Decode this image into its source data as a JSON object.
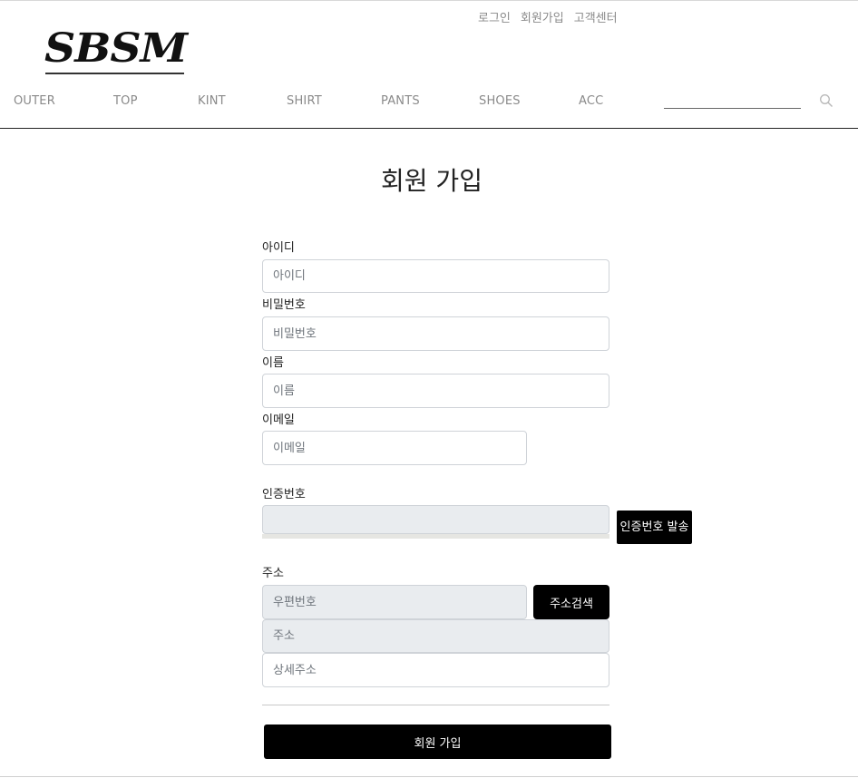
{
  "header": {
    "util_links": [
      "로그인",
      "회원가입",
      "고객센터"
    ],
    "logo_text": "SBSM",
    "nav": [
      "OUTER",
      "TOP",
      "KINT",
      "SHIRT",
      "PANTS",
      "SHOES",
      "ACC"
    ],
    "search": {
      "value": "",
      "placeholder": "",
      "icon": "search-icon"
    }
  },
  "form": {
    "title": "회원 가입",
    "id": {
      "label": "아이디",
      "placeholder": "아이디"
    },
    "password": {
      "label": "비밀번호",
      "placeholder": "비밀번호"
    },
    "name": {
      "label": "이름",
      "placeholder": "이름"
    },
    "email": {
      "label": "이메일",
      "placeholder": "이메일"
    },
    "cert": {
      "label": "인증번호",
      "value": "",
      "button": "인증번호 발송"
    },
    "address": {
      "label": "주소",
      "zip_placeholder": "우편번호",
      "search_button": "주소검색",
      "addr_placeholder": "주소",
      "detail_placeholder": "상세주소"
    },
    "submit": "회원 가입"
  },
  "colors": {
    "accent": "#000000",
    "disabled_bg": "#e9ecef",
    "muted_text": "#8a8a8a"
  }
}
